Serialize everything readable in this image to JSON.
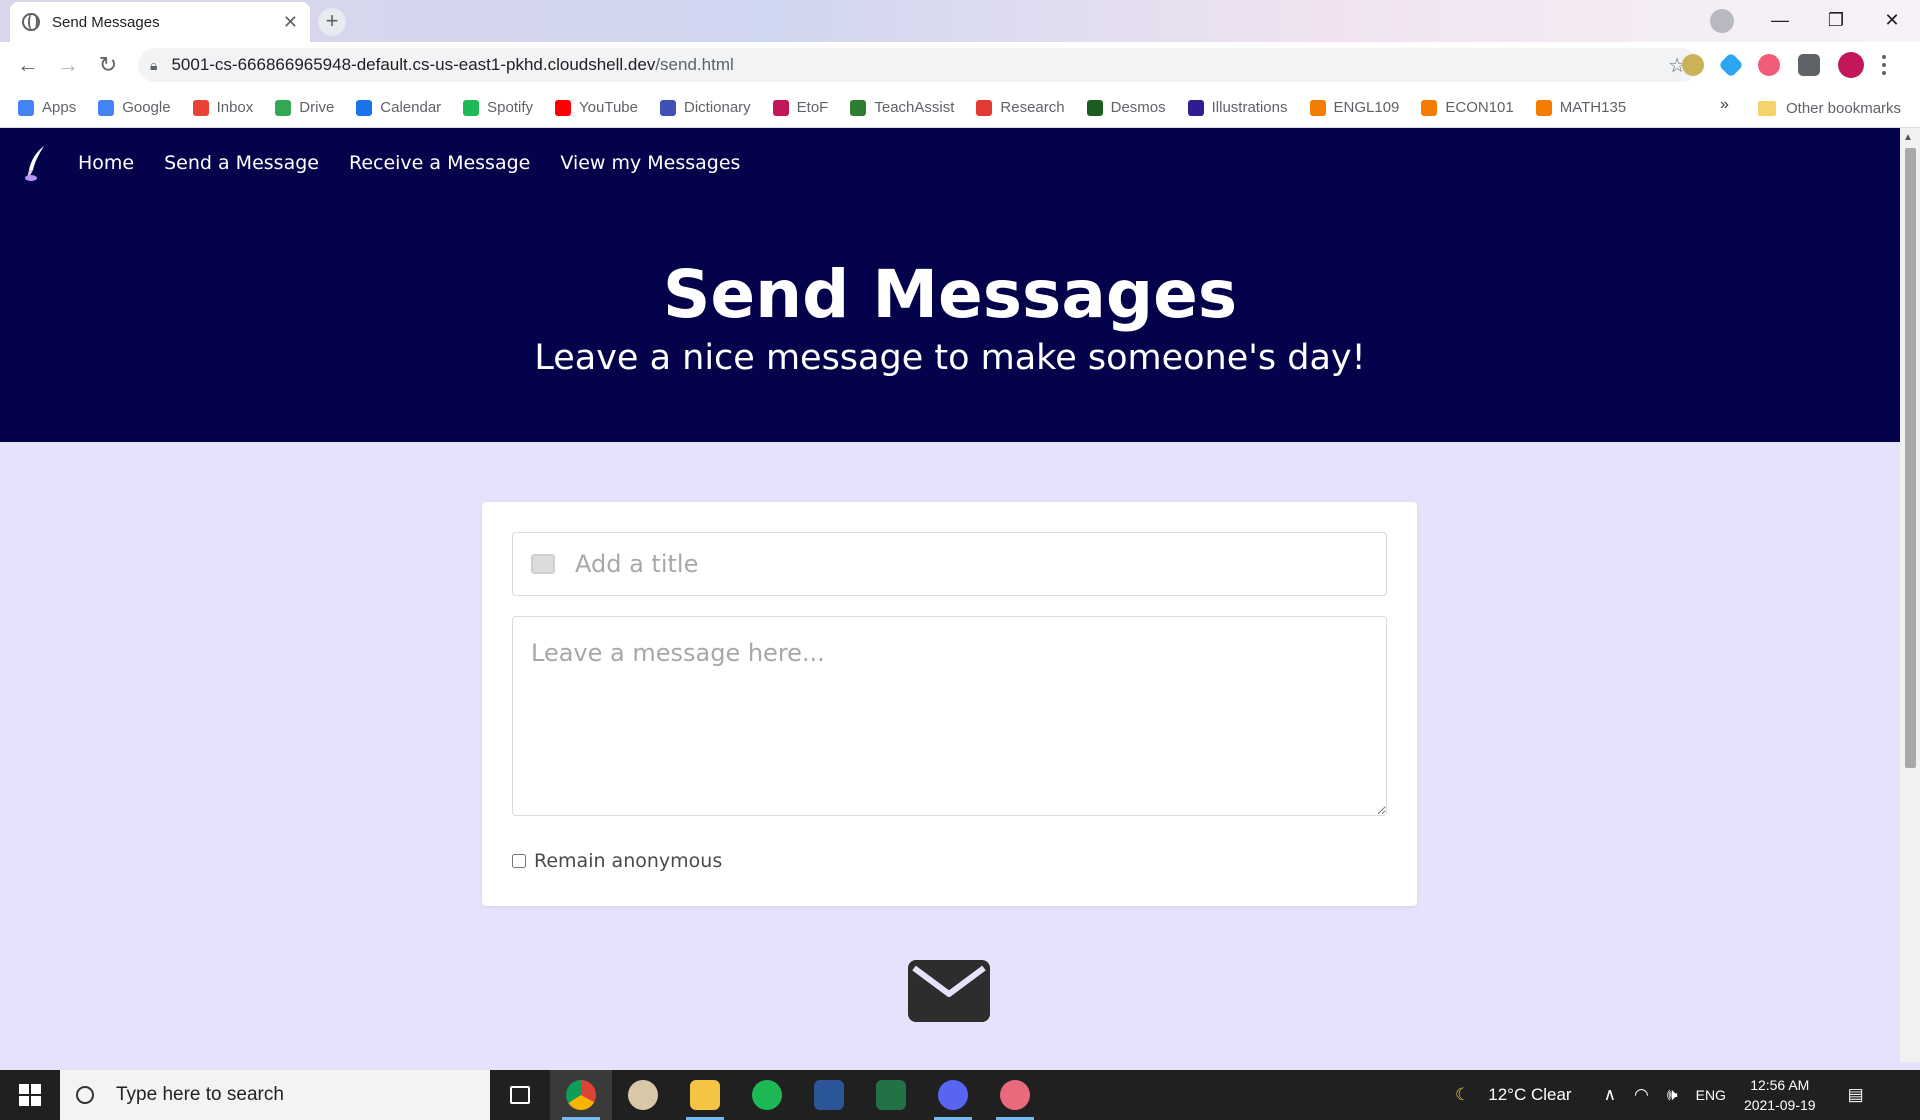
{
  "browser": {
    "tab_title": "Send Messages",
    "url_host": "5001-cs-666866965948-default.cs-us-east1-pkhd.cloudshell.dev",
    "url_path": "/send.html",
    "bookmarks": [
      "Apps",
      "Google",
      "Inbox",
      "Drive",
      "Calendar",
      "Spotify",
      "YouTube",
      "Dictionary",
      "EtoF",
      "TeachAssist",
      "Research",
      "Desmos",
      "Illustrations",
      "ENGL109",
      "ECON101",
      "MATH135"
    ],
    "bookmark_colors": [
      "#4285f4",
      "#4285f4",
      "#ea4335",
      "#34a853",
      "#1a73e8",
      "#1db954",
      "#ff0000",
      "#3f51b5",
      "#c2185b",
      "#2e7d32",
      "#e53935",
      "#1b5e20",
      "#311b92",
      "#f57c00",
      "#f57c00",
      "#f57c00"
    ],
    "more_bookmarks": "»",
    "other_bookmarks": "Other bookmarks"
  },
  "nav": {
    "links": [
      "Home",
      "Send a Message",
      "Receive a Message",
      "View my Messages"
    ]
  },
  "hero": {
    "title": "Send Messages",
    "subtitle": "Leave a nice message to make someone's day!"
  },
  "form": {
    "title_placeholder": "Add a title",
    "message_placeholder": "Leave a message here...",
    "anonymous_label": "Remain anonymous",
    "anonymous_checked": false
  },
  "taskbar": {
    "search_placeholder": "Type here to search",
    "weather": "12°C  Clear",
    "language": "ENG",
    "time": "12:56 AM",
    "date": "2021-09-19"
  },
  "colors": {
    "hero_bg": "#04024a",
    "page_bg": "#e5e3fb"
  }
}
